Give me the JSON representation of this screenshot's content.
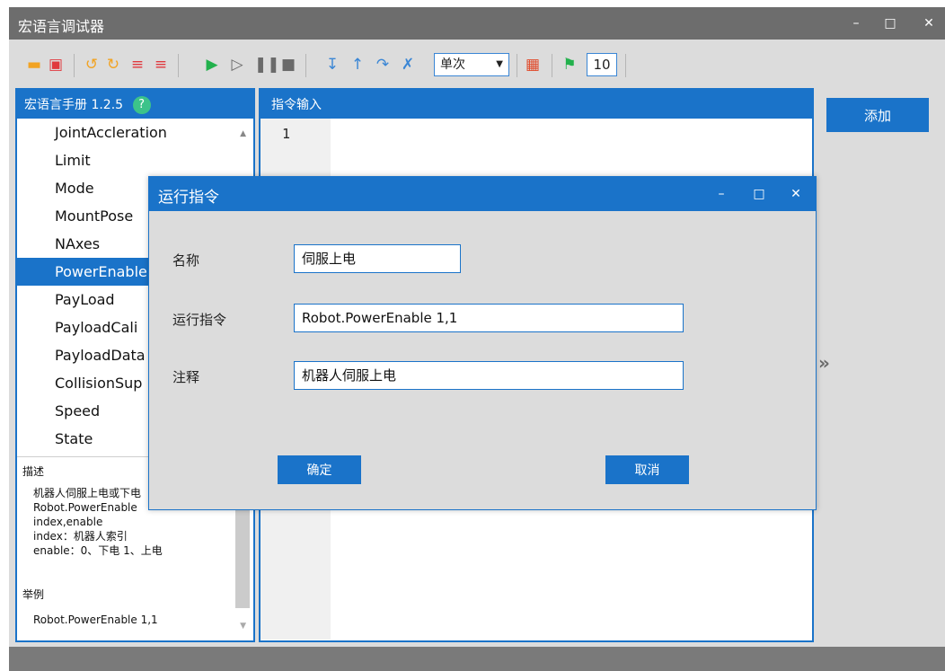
{
  "window": {
    "title": "宏语言调试器",
    "minimize": "–",
    "maximize": "□",
    "close": "✕"
  },
  "toolbar": {
    "icons": [
      "folder-open-icon",
      "save-icon",
      "undo-icon",
      "redo-icon",
      "indent-icon",
      "outdent-icon",
      "run-icon",
      "step-run-icon",
      "pause-icon",
      "stop-icon",
      "step-into-icon",
      "step-out-icon",
      "step-over-icon",
      "clear-breakpoints-icon",
      "comment-icon",
      "speed-icon"
    ],
    "run_mode": "单次",
    "speed": "10",
    "colors": {
      "orange": "#f2a323",
      "red": "#e0393e",
      "green": "#22b14c",
      "blue": "#3a86d5",
      "gray": "#6a6a6a"
    }
  },
  "manual": {
    "title": "宏语言手册 1.2.5",
    "help_glyph": "?",
    "items": [
      "JointAccleration",
      "Limit",
      "Mode",
      "MountPose",
      "NAxes",
      "PowerEnable",
      "PayLoad",
      "PayloadCali",
      "PayloadData",
      "CollisionSup",
      "Speed",
      "State"
    ],
    "selected_index": 5,
    "desc_label": "描述",
    "desc_lines": [
      "机器人伺服上电或下电",
      "Robot.PowerEnable",
      "index,enable",
      "index：机器人索引",
      "enable：0、下电 1、上电"
    ],
    "example_label": "举例",
    "example": "Robot.PowerEnable 1,1"
  },
  "input_panel": {
    "title": "指令输入",
    "line_numbers": [
      "1"
    ]
  },
  "add_button": "添加",
  "expand_glyph": "»",
  "dialog": {
    "title": "运行指令",
    "name_label": "名称",
    "name_value": "伺服上电",
    "command_label": "运行指令",
    "command_value": "Robot.PowerEnable 1,1",
    "comment_label": "注释",
    "comment_value": "机器人伺服上电",
    "ok": "确定",
    "cancel": "取消"
  }
}
